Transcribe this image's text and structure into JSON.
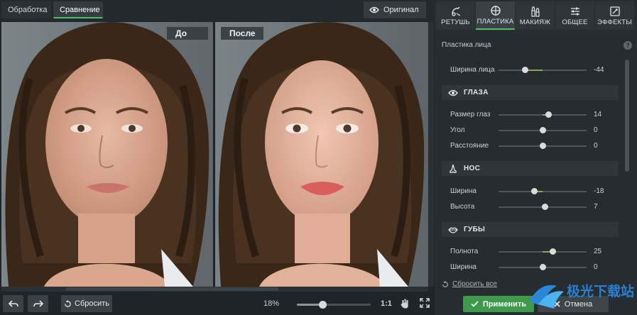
{
  "tabs": {
    "processing": "Обработка",
    "compare": "Сравнение"
  },
  "original_button": "Оригинал",
  "preview": {
    "before_label": "До",
    "after_label": "После"
  },
  "bottom": {
    "reset_label": "Сбросить",
    "zoom": "18%",
    "zoom_value": 0.35,
    "one_to_one": "1:1"
  },
  "panel_tabs": [
    {
      "label": "РЕТУШЬ",
      "icon": "retouch-brush-icon"
    },
    {
      "label": "ПЛАСТИКА",
      "icon": "plastic-crosshair-icon"
    },
    {
      "label": "МАКИЯЖ",
      "icon": "makeup-icon"
    },
    {
      "label": "ОБЩЕЕ",
      "icon": "sliders-icon"
    },
    {
      "label": "ЭФФЕКТЫ",
      "icon": "effects-icon"
    }
  ],
  "panel": {
    "section_title": "Пластика лица",
    "help": "?",
    "face_width": {
      "label": "Ширина лица",
      "value": "-44",
      "level": 0.3
    },
    "eyes": {
      "title": "ГЛАЗА",
      "rows": [
        {
          "label": "Размер глаз",
          "value": "14",
          "level": 0.57
        },
        {
          "label": "Угол",
          "value": "0",
          "level": 0.5
        },
        {
          "label": "Расстояние",
          "value": "0",
          "level": 0.5
        }
      ]
    },
    "nose": {
      "title": "НОС",
      "rows": [
        {
          "label": "Ширина",
          "value": "-18",
          "level": 0.41
        },
        {
          "label": "Высота",
          "value": "7",
          "level": 0.53
        }
      ]
    },
    "lips": {
      "title": "ГУБЫ",
      "rows": [
        {
          "label": "Полнота",
          "value": "25",
          "level": 0.62
        },
        {
          "label": "Ширина",
          "value": "0",
          "level": 0.5
        }
      ]
    },
    "reset_all": "Сбросить все",
    "apply": "Применить",
    "cancel": "Отмена"
  },
  "watermark": "极光下载站",
  "colors": {
    "accent": "#4fc05e",
    "apply": "#3e9a4a",
    "panel": "#262c30"
  }
}
